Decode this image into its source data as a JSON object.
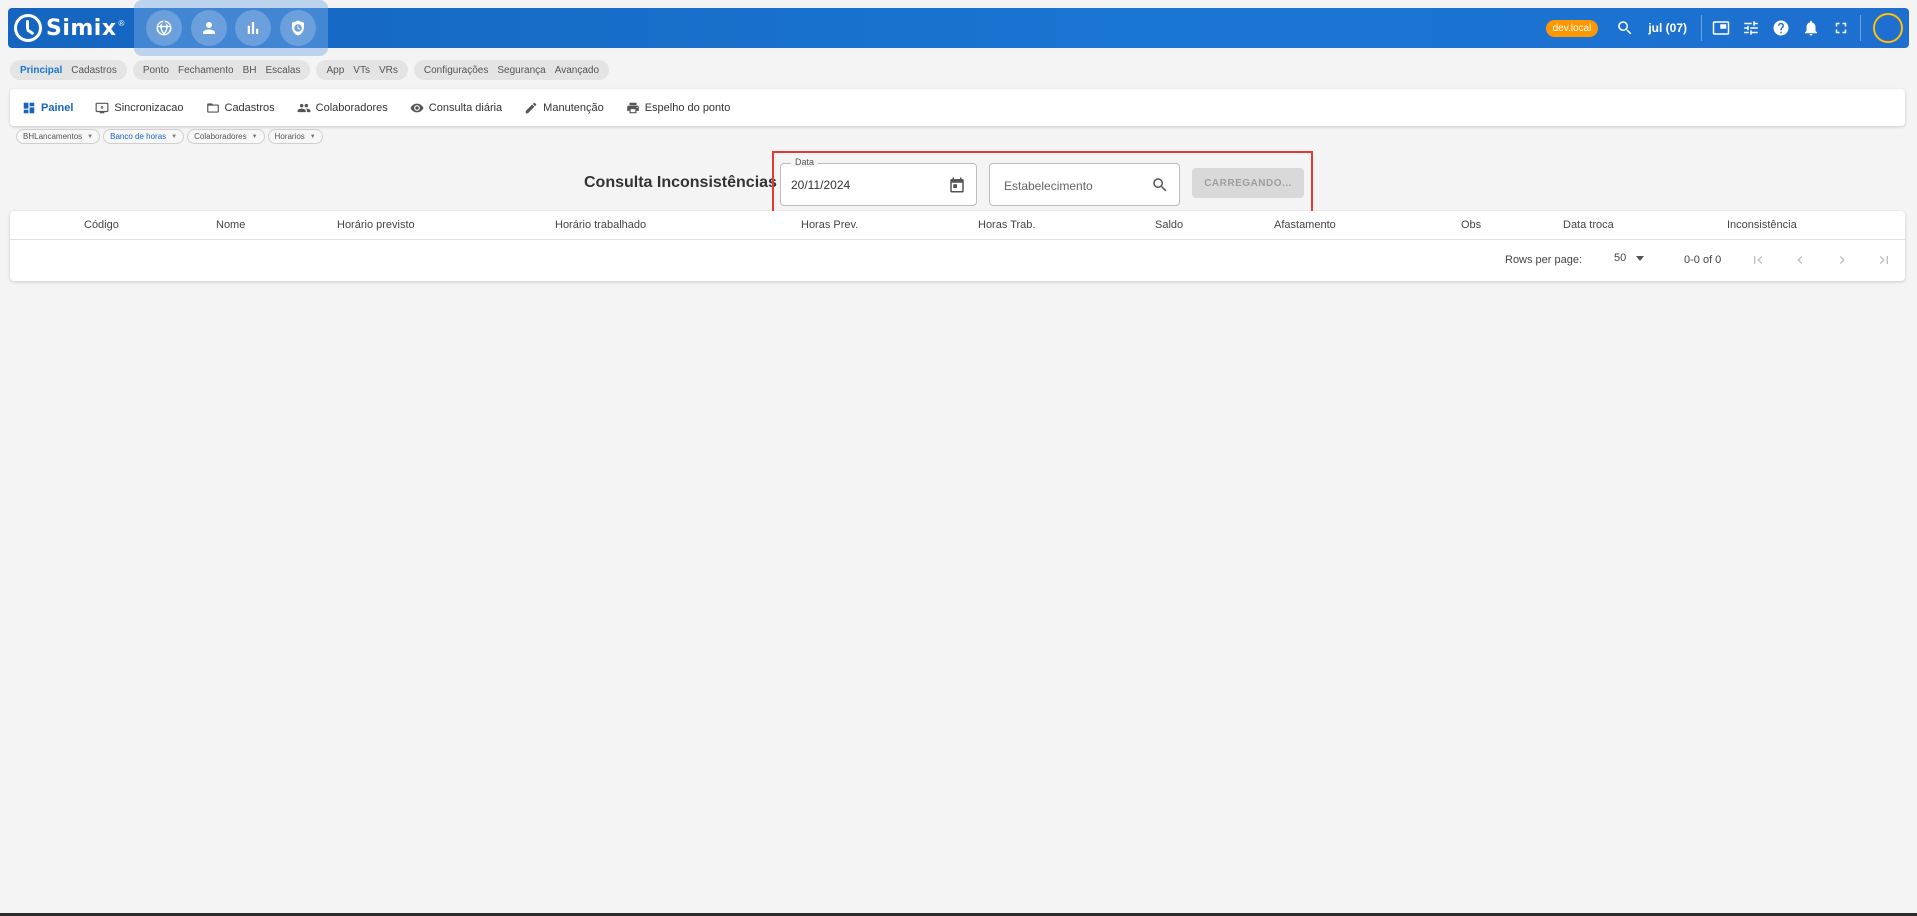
{
  "app": {
    "brand": "Simix",
    "brand_mark": "®"
  },
  "topbar": {
    "quick_actions": [
      "globe-icon",
      "person-icon",
      "bar-chart-icon",
      "shield-clock-icon"
    ],
    "env_badge": "dev.local",
    "period": "jul (07)",
    "icons": [
      "search-icon",
      "picture-in-picture-icon",
      "tune-icon",
      "help-icon",
      "bell-icon",
      "fullscreen-icon"
    ]
  },
  "modules": {
    "groups": [
      {
        "items": [
          "Principal",
          "Cadastros"
        ]
      },
      {
        "items": [
          "Ponto",
          "Fechamento",
          "BH",
          "Escalas"
        ]
      },
      {
        "items": [
          "App",
          "VTs",
          "VRs"
        ]
      },
      {
        "items": [
          "Configurações",
          "Segurança",
          "Avançado"
        ]
      }
    ]
  },
  "nav": {
    "items": [
      {
        "label": "Painel",
        "icon": "dashboard-icon"
      },
      {
        "label": "Sincronizacao",
        "icon": "sync-screen-icon"
      },
      {
        "label": "Cadastros",
        "icon": "folder-icon"
      },
      {
        "label": "Colaboradores",
        "icon": "people-icon"
      },
      {
        "label": "Consulta diária",
        "icon": "eye-icon"
      },
      {
        "label": "Manutenção",
        "icon": "pencil-icon"
      },
      {
        "label": "Espelho do ponto",
        "icon": "printer-icon"
      }
    ]
  },
  "subchips": [
    "BHLancamentos",
    "Banco de horas",
    "Colaboradores",
    "Horarios"
  ],
  "filters": {
    "title": "Consulta Inconsistências",
    "date_label": "Data",
    "date_value": "20/11/2024",
    "establishment_placeholder": "Estabelecimento",
    "load_button": "CARREGANDO..."
  },
  "table": {
    "columns": [
      "Código",
      "Nome",
      "Horário previsto",
      "Horário trabalhado",
      "Horas Prev.",
      "Horas Trab.",
      "Saldo",
      "Afastamento",
      "Obs",
      "Data troca",
      "Inconsistência"
    ],
    "rows": [],
    "footer": {
      "rows_per_page_label": "Rows per page:",
      "rows_per_page": "50",
      "range": "0-0 of 0"
    }
  },
  "colors": {
    "primary": "#1976d2",
    "accent": "#ff9800",
    "highlight": "#e53935"
  }
}
